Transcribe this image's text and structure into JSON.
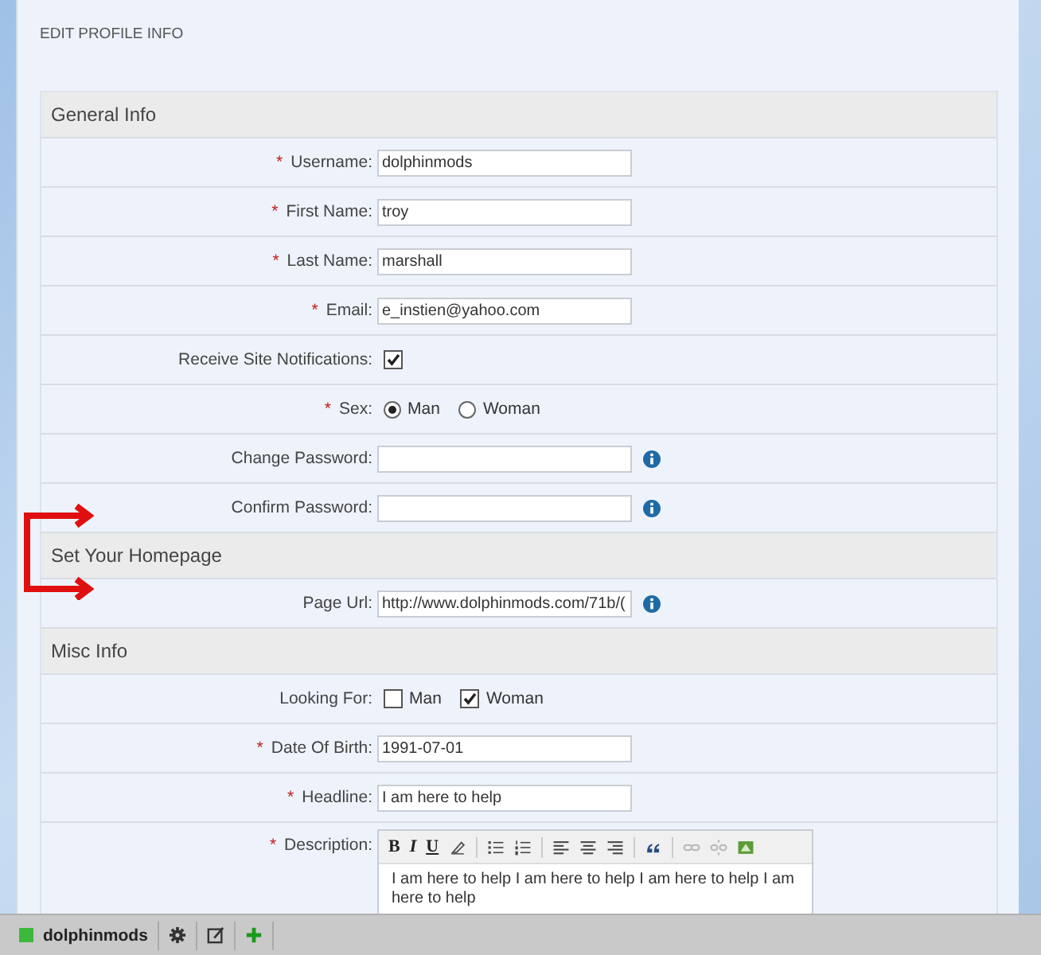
{
  "page_title": "EDIT PROFILE INFO",
  "sections": [
    {
      "title": "General Info",
      "rows": [
        {
          "kind": "text",
          "label": "Username:",
          "marker": "*",
          "value": "dolphinmods",
          "info": false
        },
        {
          "kind": "text",
          "label": "First Name:",
          "marker": "*",
          "value": "troy",
          "info": false
        },
        {
          "kind": "text",
          "label": "Last Name:",
          "marker": "*",
          "value": "marshall",
          "info": false
        },
        {
          "kind": "text",
          "label": "Email:",
          "marker": "*",
          "value": "e_instien@yahoo.com",
          "info": false
        },
        {
          "kind": "checkbox",
          "label": "Receive Site Notifications:",
          "checked": true
        },
        {
          "kind": "radio",
          "label": "Sex:",
          "marker": "*",
          "options": [
            {
              "label": "Man",
              "selected": true
            },
            {
              "label": "Woman",
              "selected": false
            }
          ]
        },
        {
          "kind": "text",
          "label": "Change Password:",
          "value": "",
          "info": true
        },
        {
          "kind": "text",
          "label": "Confirm Password:",
          "value": "",
          "info": true
        }
      ]
    },
    {
      "title": "Set Your Homepage",
      "rows": [
        {
          "kind": "text",
          "label": "Page Url:",
          "value": "http://www.dolphinmods.com/71b/(",
          "info": true
        }
      ]
    },
    {
      "title": "Misc Info",
      "rows": [
        {
          "kind": "checks",
          "label": "Looking For:",
          "options": [
            {
              "label": "Man",
              "checked": false
            },
            {
              "label": "Woman",
              "checked": true
            }
          ]
        },
        {
          "kind": "text",
          "label": "Date Of Birth:",
          "marker": "*",
          "value": "1991-07-01",
          "info": false
        },
        {
          "kind": "text",
          "label": "Headline:",
          "marker": "*",
          "value": "I am here to help",
          "info": false
        },
        {
          "kind": "editor",
          "label": "Description:",
          "marker": "*",
          "toolbar": [
            {
              "kind": "char",
              "label": "B"
            },
            {
              "kind": "char",
              "label": "I"
            },
            {
              "kind": "char",
              "label": "U"
            },
            {
              "kind": "eraser"
            },
            {
              "kind": "sep"
            },
            {
              "kind": "bullets"
            },
            {
              "kind": "numbers"
            },
            {
              "kind": "sep"
            },
            {
              "kind": "left"
            },
            {
              "kind": "center"
            },
            {
              "kind": "right"
            },
            {
              "kind": "sep"
            },
            {
              "kind": "quote"
            },
            {
              "kind": "sep"
            },
            {
              "kind": "link"
            },
            {
              "kind": "unlink"
            },
            {
              "kind": "image"
            }
          ],
          "value": "I am here to help I am here to help I am here to help I am here to help"
        }
      ]
    }
  ],
  "taskbar": {
    "user": "dolphinmods"
  }
}
